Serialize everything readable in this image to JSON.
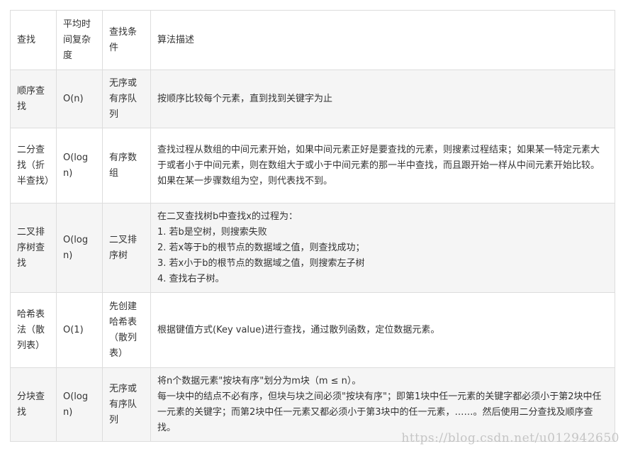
{
  "table": {
    "headers": [
      "查找",
      "平均时间复杂度",
      "查找条件",
      "算法描述"
    ],
    "rows": [
      {
        "name": "顺序查找",
        "complexity": "O(n)",
        "condition": "无序或有序队列",
        "description": [
          "按顺序比较每个元素，直到找到关键字为止"
        ]
      },
      {
        "name": "二分查找（折半查找）",
        "complexity": "O(logn)",
        "condition": "有序数组",
        "description": [
          "查找过程从数组的中间元素开始，如果中间元素正好是要查找的元素，则搜素过程结束；如果某一特定元素大于或者小于中间元素，则在数组大于或小于中间元素的那一半中查找，而且跟开始一样从中间元素开始比较。　如果在某一步骤数组为空，则代表找不到。"
        ]
      },
      {
        "name": "二叉排序树查找",
        "complexity": "O(logn)",
        "condition": "二叉排序树",
        "description": [
          "在二叉查找树b中查找x的过程为：",
          "1. 若b是空树，则搜索失败",
          "2. 若x等于b的根节点的数据域之值，则查找成功；",
          "3. 若x小于b的根节点的数据域之值，则搜索左子树",
          "4. 查找右子树。"
        ]
      },
      {
        "name": "哈希表法（散列表）",
        "complexity": "O(1)",
        "condition": "先创建哈希表（散列表）",
        "description": [
          "根据键值方式(Key value)进行查找，通过散列函数，定位数据元素。"
        ]
      },
      {
        "name": "分块查找",
        "complexity": "O(logn)",
        "condition": "无序或有序队列",
        "description": [
          "将n个数据元素\"按块有序\"划分为m块（m ≤ n）。",
          "每一块中的结点不必有序，但块与块之间必须\"按块有序\"；即第1块中任一元素的关键字都必须小于第2块中任一元素的关键字；而第2块中任一元素又都必须小于第3块中的任一元素，……。然后使用二分查找及顺序查找。"
        ]
      }
    ]
  },
  "watermark": "https://blog.csdn.net/u012942650"
}
